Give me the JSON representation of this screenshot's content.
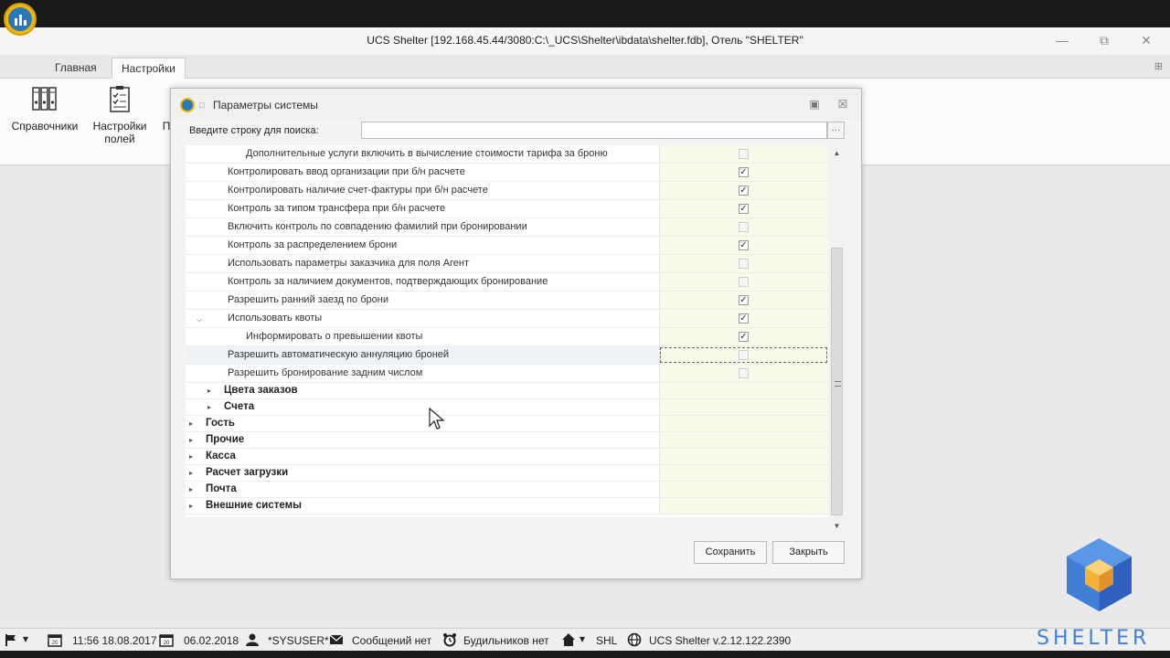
{
  "window": {
    "title": "UCS Shelter [192.168.45.44/3080:C:\\_UCS\\Shelter\\ibdata\\shelter.fdb], Отель \"SHELTER\""
  },
  "ribbon": {
    "tabs": [
      "Главная",
      "Настройки"
    ],
    "active_tab": "Настройки",
    "buttons": [
      {
        "label": "Справочники",
        "icon": "binders-icon"
      },
      {
        "label": "Настройки полей",
        "icon": "clipboard-checklist-icon"
      },
      {
        "label": "П",
        "icon": "partial-icon"
      }
    ]
  },
  "dialog": {
    "title": "Параметры системы",
    "search_label": "Введите строку для поиска:",
    "search_value": "",
    "rows": [
      {
        "label": "Дополнительные услуги включить в вычисление стоимости тарифа за броню",
        "checked": false,
        "level": 2
      },
      {
        "label": "Контролировать ввод организации при б/н расчете",
        "checked": true,
        "level": 1
      },
      {
        "label": "Контролировать наличие счет-фактуры при б/н расчете",
        "checked": true,
        "level": 1
      },
      {
        "label": "Контроль за типом трансфера при б/н расчете",
        "checked": true,
        "level": 1
      },
      {
        "label": "Включить контроль по совпадению фамилий при бронировании",
        "checked": false,
        "level": 1
      },
      {
        "label": "Контроль за распределением брони",
        "checked": true,
        "level": 1
      },
      {
        "label": "Использовать параметры заказчика для поля Агент",
        "checked": false,
        "level": 1
      },
      {
        "label": "Контроль за наличием документов, подтверждающих бронирование",
        "checked": false,
        "level": 1
      },
      {
        "label": "Разрешить ранний заезд по брони",
        "checked": true,
        "level": 1
      },
      {
        "label": "Использовать квоты",
        "checked": true,
        "level": 1,
        "expanded": true
      },
      {
        "label": "Информировать о превышении квоты",
        "checked": true,
        "level": 2
      },
      {
        "label": "Разрешить автоматическую аннуляцию броней",
        "checked": false,
        "level": 1,
        "selected": true
      },
      {
        "label": "Разрешить бронирование задним числом",
        "checked": false,
        "level": 1
      }
    ],
    "groups": [
      {
        "label": "Цвета заказов",
        "level": 1
      },
      {
        "label": "Счета",
        "level": 1
      },
      {
        "label": "Гость",
        "level": 0
      },
      {
        "label": "Прочие",
        "level": 0
      },
      {
        "label": "Касса",
        "level": 0
      },
      {
        "label": "Расчет загрузки",
        "level": 0
      },
      {
        "label": "Почта",
        "level": 0
      },
      {
        "label": "Внешние системы",
        "level": 0
      }
    ],
    "save_label": "Сохранить",
    "close_label": "Закрыть"
  },
  "status": {
    "datetime": "11:56 18.08.2017",
    "date2": "06.02.2018",
    "user": "*SYSUSER*",
    "messages": "Сообщений нет",
    "alarms": "Будильников нет",
    "hotel": "SHL",
    "version": "UCS Shelter v.2.12.122.2390"
  },
  "brand": {
    "name": "SHELTER",
    "color": "#3f7fd6"
  }
}
